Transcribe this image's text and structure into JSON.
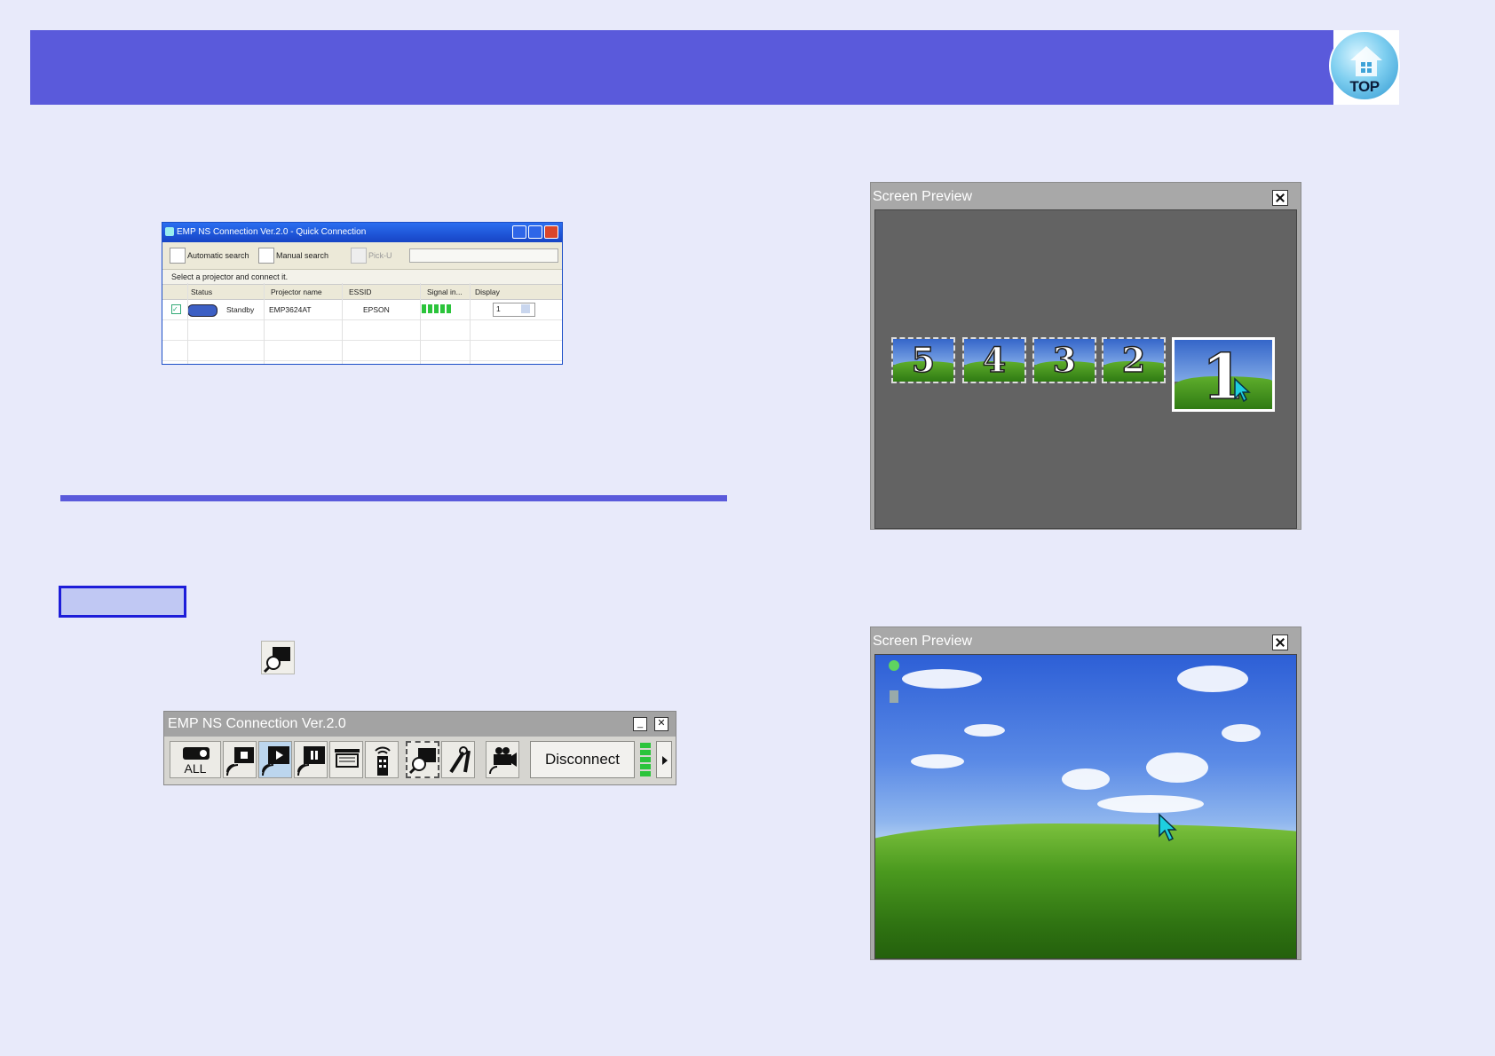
{
  "header": {
    "top_button_label": "TOP"
  },
  "quick_connection": {
    "title": "EMP NS Connection Ver.2.0 - Quick Connection",
    "toolbar": {
      "automatic_search": "Automatic search",
      "manual_search": "Manual search",
      "pick_up": "Pick-U"
    },
    "hint": "Select a projector and connect it.",
    "columns": [
      "Status",
      "Projector name",
      "ESSID",
      "Signal in...",
      "Display"
    ],
    "row": {
      "status": "Standby",
      "projector_name": "EMP3624AT",
      "essid": "EPSON",
      "display": "1"
    }
  },
  "toolbar_window": {
    "title": "EMP NS Connection Ver.2.0",
    "all_label": "ALL",
    "disconnect_label": "Disconnect"
  },
  "preview_top": {
    "title": "Screen Preview",
    "thumbnails": [
      "5",
      "4",
      "3",
      "2",
      "1"
    ]
  },
  "preview_bottom": {
    "title": "Screen Preview"
  },
  "colors": {
    "header": "#5a5adb",
    "background": "#e8eafa",
    "accent_box": "#1d1dd9"
  }
}
